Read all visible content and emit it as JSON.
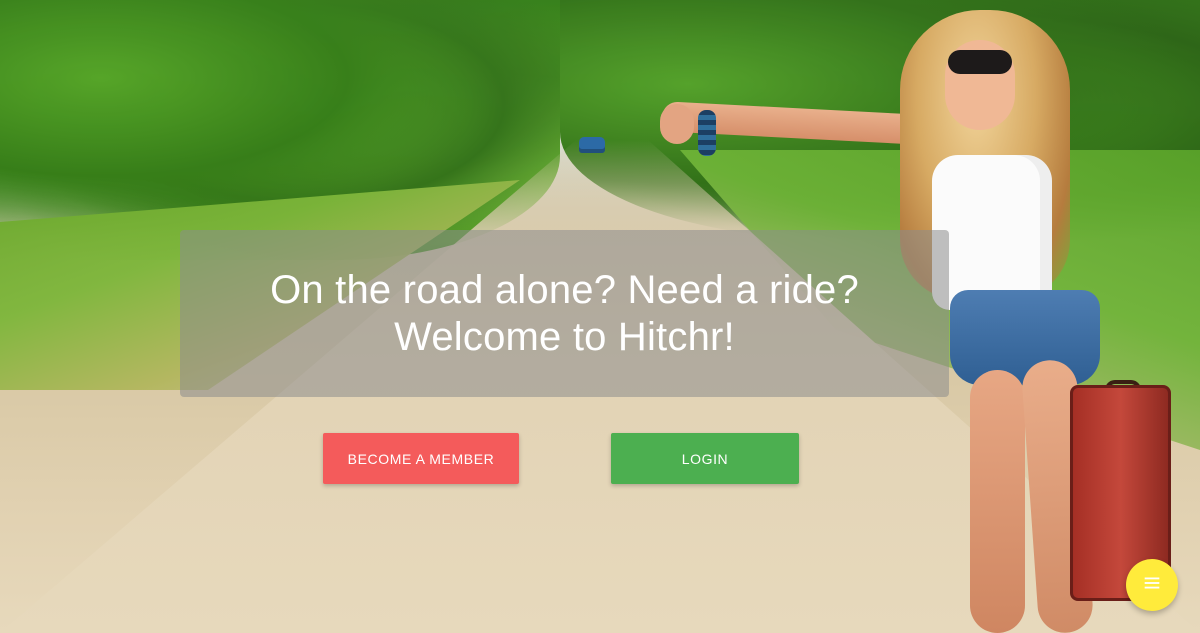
{
  "hero": {
    "headline_line1": "On the road alone? Need a ride?",
    "headline_line2": "Welcome to Hitchr!"
  },
  "actions": {
    "become_member_label": "BECOME A MEMBER",
    "login_label": "LOGIN"
  },
  "fab": {
    "icon": "menu-icon"
  },
  "colors": {
    "become_member_bg": "#f45b5b",
    "login_bg": "#4caf50",
    "fab_bg": "#ffeb3b",
    "overlay_panel": "rgba(140,140,140,0.55)"
  }
}
